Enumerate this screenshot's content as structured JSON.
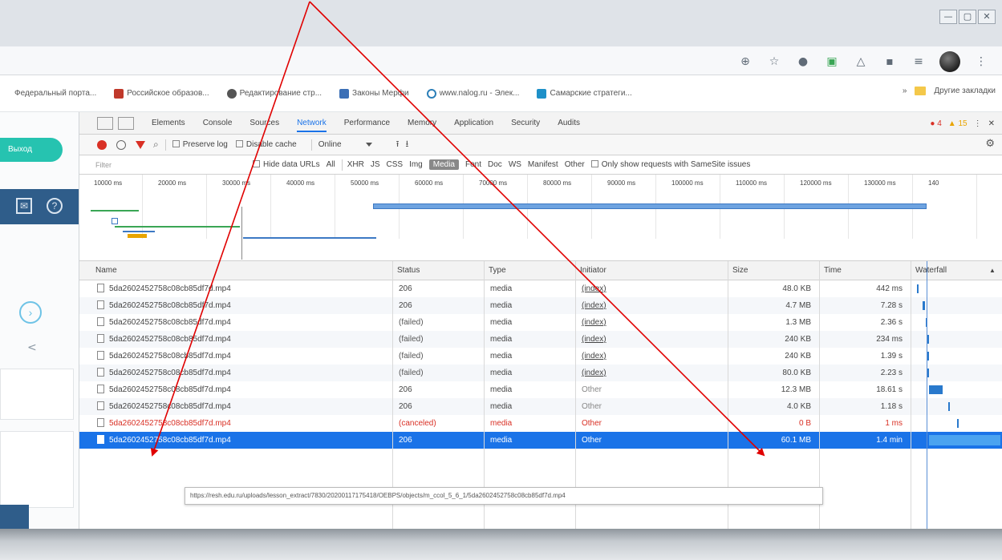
{
  "window": {
    "controls": [
      "—",
      "▢",
      "✕"
    ]
  },
  "toolbar": {
    "icons": [
      "zoom-icon",
      "star-icon",
      "extension-icon",
      "app-icon",
      "bell-icon",
      "ext2-icon",
      "menu-icon",
      "avatar",
      "more-icon"
    ]
  },
  "bookmarks": {
    "items": [
      {
        "label": "Федеральный порта...",
        "color": "#ffffff"
      },
      {
        "label": "Российское образов...",
        "color": "#c0392b"
      },
      {
        "label": "Редактирование стр...",
        "color": "#555555"
      },
      {
        "label": "Законы Мерфи",
        "color": "#3b6fb6"
      },
      {
        "label": "www.nalog.ru - Элек...",
        "color": "#2c7fb8"
      },
      {
        "label": "Самарские стратеги...",
        "color": "#1e90c8"
      }
    ],
    "more": "»",
    "other": "Другие закладки"
  },
  "page": {
    "exit_button": "Выход"
  },
  "devtools": {
    "tabs": [
      "Elements",
      "Console",
      "Sources",
      "Network",
      "Performance",
      "Memory",
      "Application",
      "Security",
      "Audits"
    ],
    "active_tab": "Network",
    "errors": "4",
    "warnings": "15",
    "toolbar": {
      "preserve_log": "Preserve log",
      "disable_cache": "Disable cache",
      "throttle": "Online"
    },
    "filter": {
      "placeholder": "Filter",
      "hide_data_urls": "Hide data URLs",
      "types": [
        "All",
        "XHR",
        "JS",
        "CSS",
        "Img",
        "Media",
        "Font",
        "Doc",
        "WS",
        "Manifest",
        "Other"
      ],
      "active_type": "Media",
      "samesite": "Only show requests with SameSite issues"
    },
    "timeline_ticks": [
      "10000 ms",
      "20000 ms",
      "30000 ms",
      "40000 ms",
      "50000 ms",
      "60000 ms",
      "70000 ms",
      "80000 ms",
      "90000 ms",
      "100000 ms",
      "110000 ms",
      "120000 ms",
      "130000 ms",
      "140"
    ],
    "columns": [
      "Name",
      "Status",
      "Type",
      "Initiator",
      "Size",
      "Time",
      "Waterfall"
    ],
    "rows": [
      {
        "name": "5da2602452758c08cb85df7d.mp4",
        "status": "206",
        "type": "media",
        "initiator": "(index)",
        "size": "48.0 KB",
        "time": "442 ms",
        "state": "normal",
        "wf_start": 0.04,
        "wf_width": 0.02
      },
      {
        "name": "5da2602452758c08cb85df7d.mp4",
        "status": "206",
        "type": "media",
        "initiator": "(index)",
        "size": "4.7 MB",
        "time": "7.28 s",
        "state": "normal",
        "wf_start": 0.1,
        "wf_width": 0.03
      },
      {
        "name": "5da2602452758c08cb85df7d.mp4",
        "status": "(failed)",
        "type": "media",
        "initiator": "(index)",
        "size": "1.3 MB",
        "time": "2.36 s",
        "state": "failed",
        "wf_start": 0.14,
        "wf_width": 0.02
      },
      {
        "name": "5da2602452758c08cb85df7d.mp4",
        "status": "(failed)",
        "type": "media",
        "initiator": "(index)",
        "size": "240 KB",
        "time": "234 ms",
        "state": "failed",
        "wf_start": 0.16,
        "wf_width": 0.02
      },
      {
        "name": "5da2602452758c08cb85df7d.mp4",
        "status": "(failed)",
        "type": "media",
        "initiator": "(index)",
        "size": "240 KB",
        "time": "1.39 s",
        "state": "failed",
        "wf_start": 0.16,
        "wf_width": 0.02
      },
      {
        "name": "5da2602452758c08cb85df7d.mp4",
        "status": "(failed)",
        "type": "media",
        "initiator": "(index)",
        "size": "80.0 KB",
        "time": "2.23 s",
        "state": "failed",
        "wf_start": 0.16,
        "wf_width": 0.02
      },
      {
        "name": "5da2602452758c08cb85df7d.mp4",
        "status": "206",
        "type": "media",
        "initiator": "Other",
        "size": "12.3 MB",
        "time": "18.61 s",
        "state": "normal",
        "wf_start": 0.18,
        "wf_width": 0.15
      },
      {
        "name": "5da2602452758c08cb85df7d.mp4",
        "status": "206",
        "type": "media",
        "initiator": "Other",
        "size": "4.0 KB",
        "time": "1.18 s",
        "state": "normal",
        "wf_start": 0.4,
        "wf_width": 0.02
      },
      {
        "name": "5da2602452758c08cb85df7d.mp4",
        "status": "(canceled)",
        "type": "media",
        "initiator": "Other",
        "size": "0 B",
        "time": "1 ms",
        "state": "canceled",
        "wf_start": 0.5,
        "wf_width": 0.0
      },
      {
        "name": "5da2602452758c08cb85df7d.mp4",
        "status": "206",
        "type": "media",
        "initiator": "Other",
        "size": "60.1 MB",
        "time": "1.4 min",
        "state": "selected",
        "wf_start": 0.18,
        "wf_width": 0.82
      }
    ],
    "tooltip": "https://resh.edu.ru/uploads/lesson_extract/7830/20200117175418/OEBPS/objects/m_ccol_5_6_1/5da2602452758c08cb85df7d.mp4"
  },
  "colors": {
    "accent": "#1a73e8",
    "annotation": "#e00000",
    "exit": "#26c3b0"
  }
}
